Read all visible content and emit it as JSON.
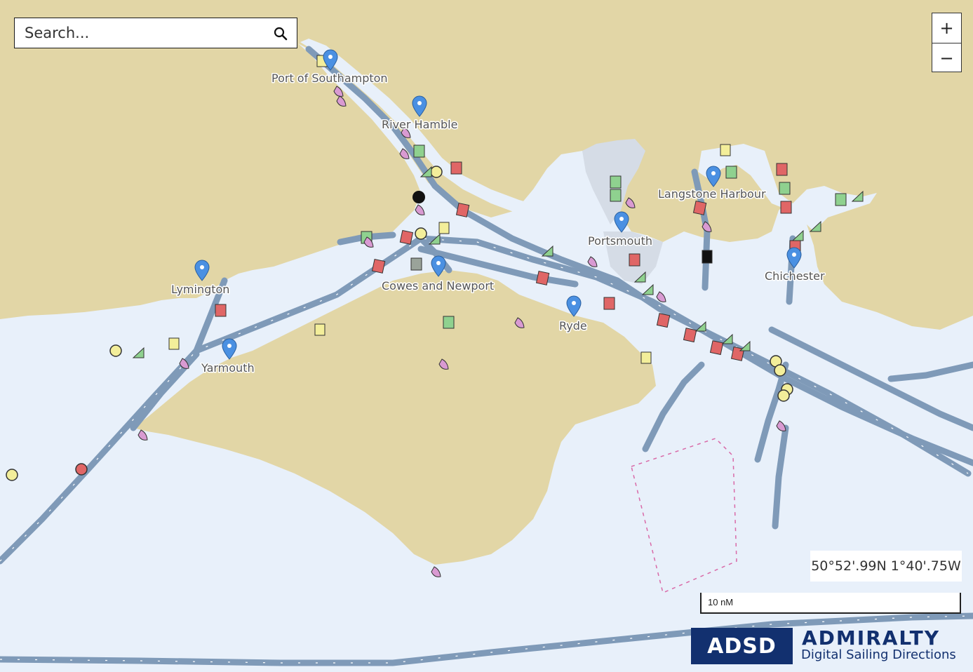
{
  "search": {
    "placeholder": "Search..."
  },
  "zoom": {
    "in_label": "+",
    "out_label": "−"
  },
  "coordinates": {
    "text": "50°52'.99N 1°40'.75W"
  },
  "scale": {
    "label": "10 nM"
  },
  "brand": {
    "badge": "ADSD",
    "title": "ADMIRALTY",
    "subtitle": "Digital Sailing Directions"
  },
  "colors": {
    "land": "#e2d6a6",
    "sea": "#e8f0fa",
    "shallow": "#d5e3f3",
    "lanes": "#7f9ab8",
    "marker_red": "#e06666",
    "marker_green": "#8fd18f",
    "marker_yellow": "#f3ee9a",
    "marker_pink": "#d99ad2",
    "pin_blue": "#4a90e2"
  },
  "places": [
    {
      "name": "Port of Southampton"
    },
    {
      "name": "River Hamble"
    },
    {
      "name": "Langstone Harbour"
    },
    {
      "name": "Portsmouth"
    },
    {
      "name": "Chichester"
    },
    {
      "name": "Lymington"
    },
    {
      "name": "Cowes and Newport"
    },
    {
      "name": "Ryde"
    },
    {
      "name": "Yarmouth"
    }
  ]
}
